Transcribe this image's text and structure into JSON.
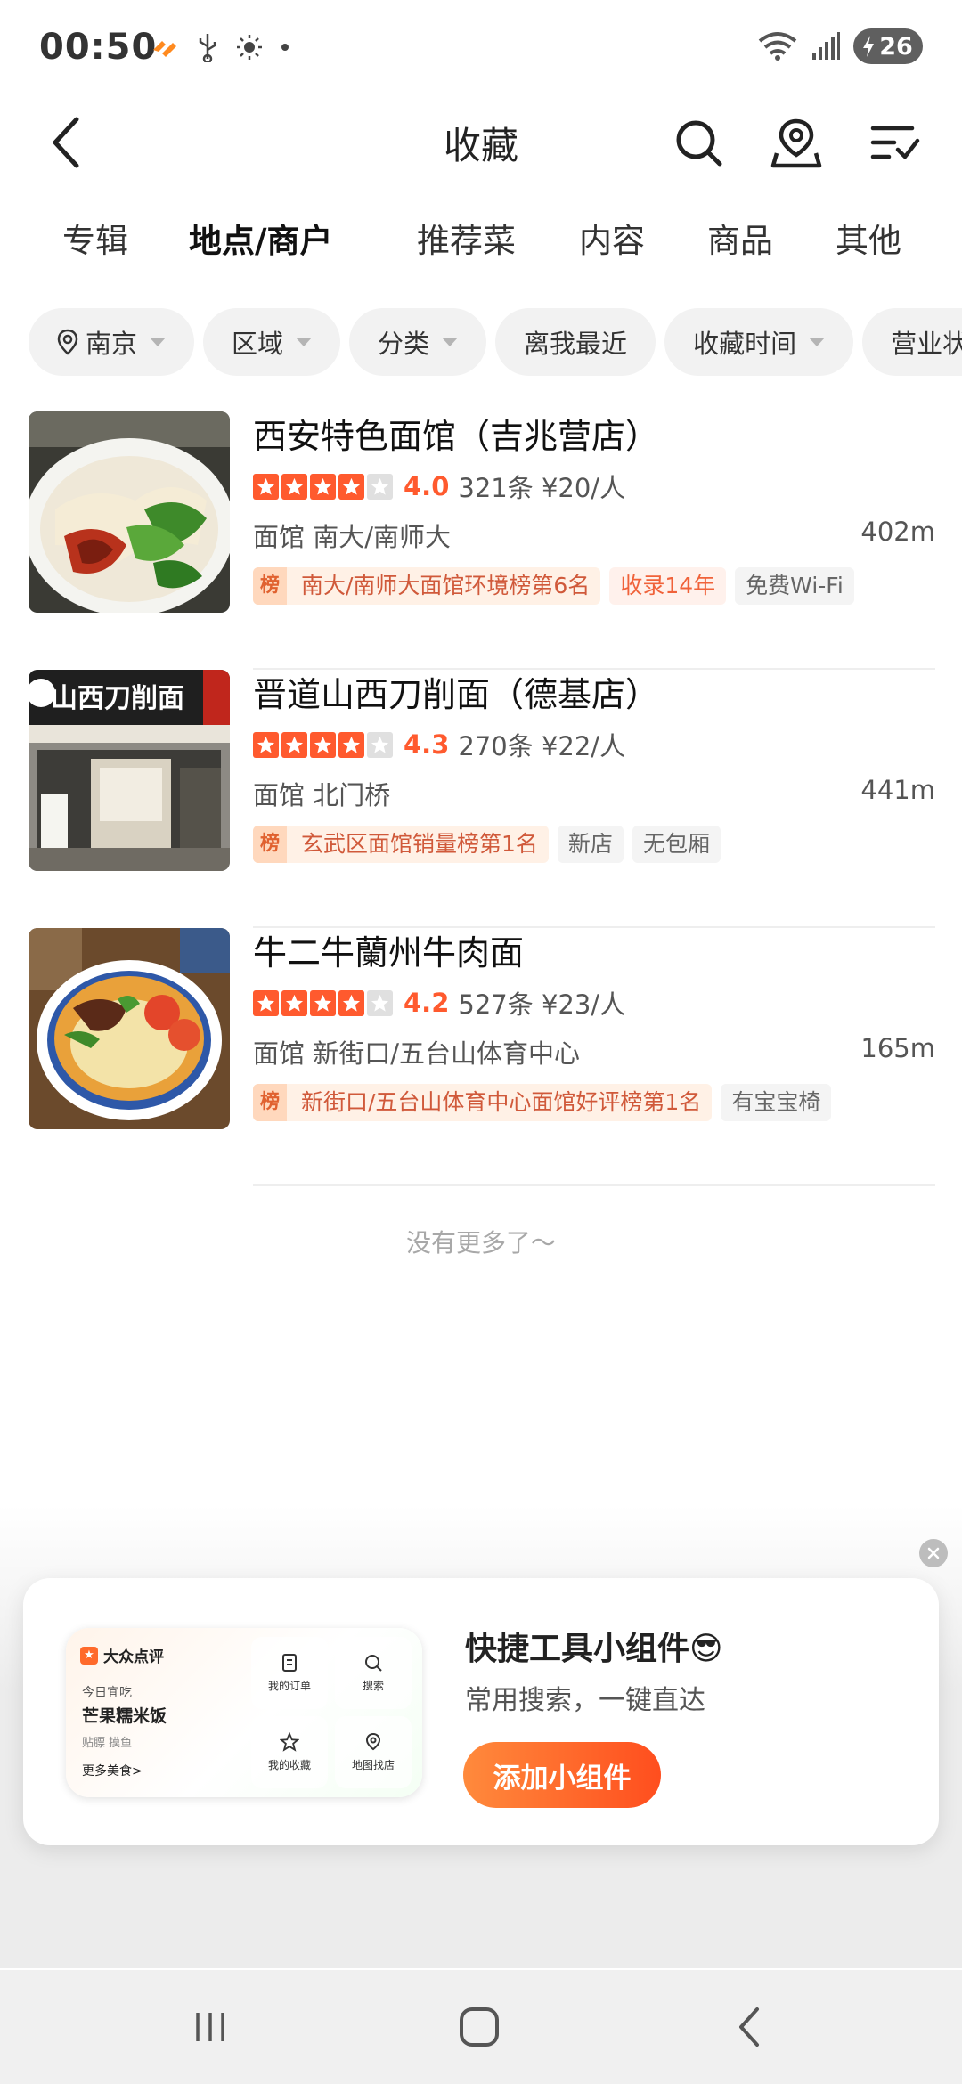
{
  "status_bar": {
    "time": "00:50",
    "battery": "26"
  },
  "header": {
    "title": "收藏"
  },
  "tabs": [
    {
      "label": "专辑"
    },
    {
      "label": "地点/商户"
    },
    {
      "label": "推荐菜"
    },
    {
      "label": "内容"
    },
    {
      "label": "商品"
    },
    {
      "label": "其他"
    }
  ],
  "active_tab": "地点/商户",
  "filters": {
    "city": "南京",
    "area": "区域",
    "category": "分类",
    "nearest": "离我最近",
    "saved_time": "收藏时间",
    "hours": "营业状态"
  },
  "items": [
    {
      "name": "西安特色面馆（吉兆营店）",
      "rating": 4.0,
      "score": "4.0",
      "reviews": "321条 ¥20/人",
      "category_area": "面馆 南大/南师大",
      "distance": "402m",
      "rank_badge": "榜",
      "rank_text": "南大/南师大面馆环境榜第6名",
      "tag2": "收录14年",
      "tag3": "免费Wi-Fi"
    },
    {
      "name": "晋道山西刀削面（德基店）",
      "rating": 4.3,
      "score": "4.3",
      "reviews": "270条 ¥22/人",
      "category_area": "面馆 北门桥",
      "distance": "441m",
      "rank_badge": "榜",
      "rank_text": "玄武区面馆销量榜第1名",
      "tag2": "新店",
      "tag3": "无包厢",
      "thumb_sign": "山西刀削面"
    },
    {
      "name": "牛二牛蘭州牛肉面",
      "rating": 4.2,
      "score": "4.2",
      "reviews": "527条 ¥23/人",
      "category_area": "面馆 新街口/五台山体育中心",
      "distance": "165m",
      "rank_badge": "榜",
      "rank_text": "新街口/五台山体育中心面馆好评榜第1名",
      "tag2": "有宝宝椅"
    }
  ],
  "no_more": "没有更多了～",
  "widget_popup": {
    "title": "快捷工具小组件😎",
    "subtitle": "常用搜索，一键直达",
    "button": "添加小组件",
    "preview": {
      "brand": "大众点评",
      "today_label": "今日宜吃",
      "dish": "芒果糯米饭",
      "extras": "贴膘 摸鱼",
      "more": "更多美食>",
      "cells": [
        "我的订单",
        "搜索",
        "我的收藏",
        "地图找店"
      ]
    }
  },
  "colors": {
    "accent": "#ff5a2e",
    "rank_bg": "#fff1e6"
  }
}
